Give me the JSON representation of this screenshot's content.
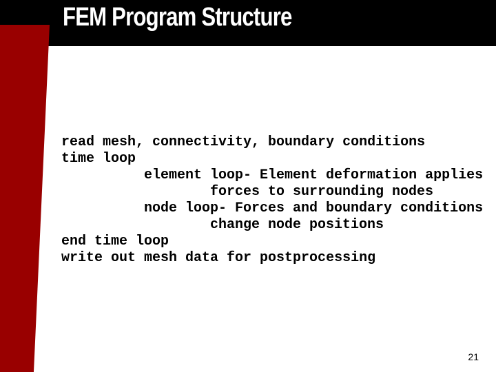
{
  "slide": {
    "title": "FEM Program Structure",
    "page_number": "21",
    "colors": {
      "header": "#000000",
      "accent_bar": "#990000",
      "background": "#ffffff"
    },
    "lines": [
      {
        "indent": 0,
        "text": "read mesh, connectivity, boundary conditions"
      },
      {
        "indent": 0,
        "text": "time loop"
      },
      {
        "indent": 1,
        "text": "element loop- Element deformation applies"
      },
      {
        "indent": 2,
        "text": "forces to surrounding nodes"
      },
      {
        "indent": 1,
        "text": "node loop- Forces and boundary conditions"
      },
      {
        "indent": 2,
        "text": "change node positions"
      },
      {
        "indent": 0,
        "text": "end time loop"
      },
      {
        "indent": 0,
        "text": "write out mesh data for postprocessing"
      }
    ]
  }
}
